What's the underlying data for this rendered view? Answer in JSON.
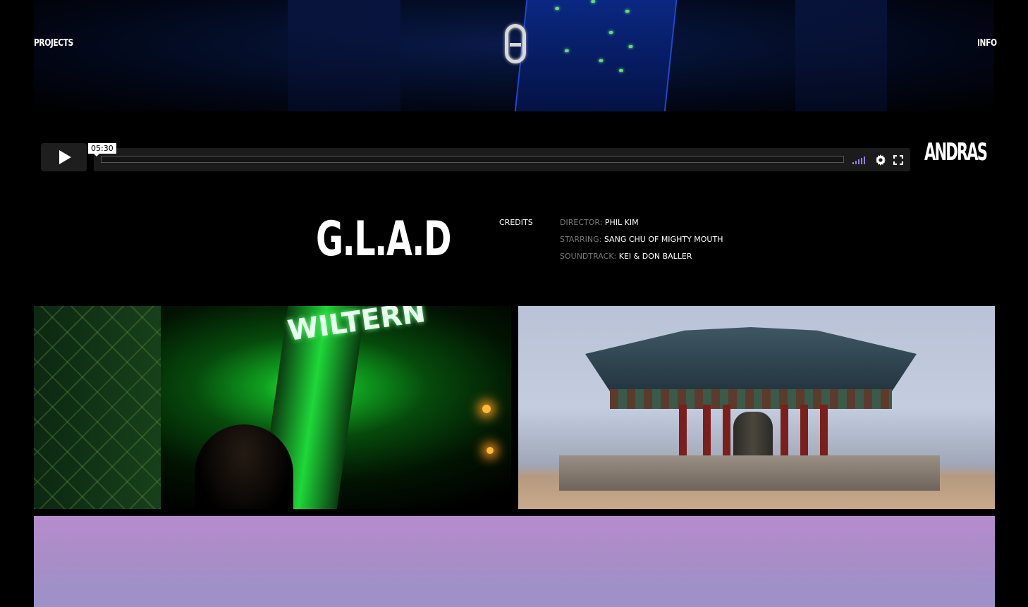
{
  "nav": {
    "projects_label": "PROJECTS",
    "info_label": "INFO"
  },
  "player": {
    "timestamp": "05:30",
    "volume_color": "#9b7de8"
  },
  "logo": {
    "text": "ANDRAS"
  },
  "project": {
    "title": "G.L.A.D",
    "credits_label": "CREDITS",
    "credits": [
      {
        "key": "DIRECTOR:",
        "value": "PHIL KIM"
      },
      {
        "key": "STARRING:",
        "value": "SANG CHU OF MIGHTY MOUTH"
      },
      {
        "key": "SOUNDTRACK:",
        "value": "KEI & DON BALLER"
      }
    ]
  },
  "stills": {
    "sign_text": "WILTERN"
  },
  "colors": {
    "background": "#000000",
    "text": "#ffffff",
    "muted": "#777777"
  }
}
